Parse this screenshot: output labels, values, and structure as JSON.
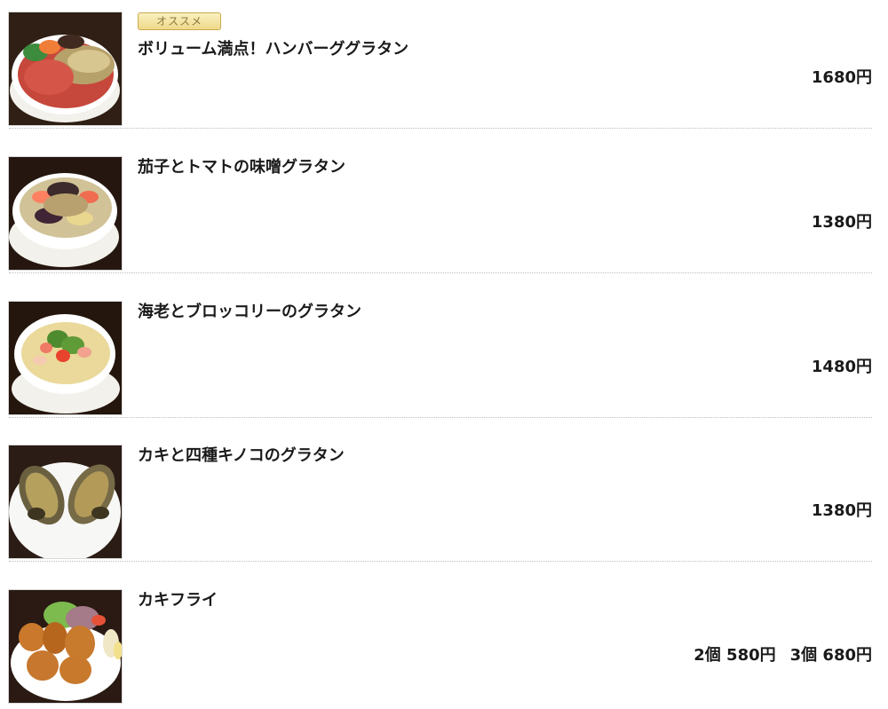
{
  "menu": {
    "items": [
      {
        "badge": "オススメ",
        "name": "ボリューム満点！ハンバーググラタン",
        "price": "1680円",
        "photo_icon": "hamburg-gratin-photo"
      },
      {
        "name": "茄子とトマトの味噌グラタン",
        "price": "1380円",
        "photo_icon": "eggplant-tomato-gratin-photo"
      },
      {
        "name": "海老とブロッコリーのグラタン",
        "price": "1480円",
        "photo_icon": "shrimp-broccoli-gratin-photo"
      },
      {
        "name": "カキと四種キノコのグラタン",
        "price": "1380円",
        "photo_icon": "oyster-mushroom-gratin-photo"
      },
      {
        "name": "カキフライ",
        "price_options": [
          "2個 580円",
          "3個 680円"
        ],
        "photo_icon": "fried-oyster-photo"
      }
    ]
  }
}
